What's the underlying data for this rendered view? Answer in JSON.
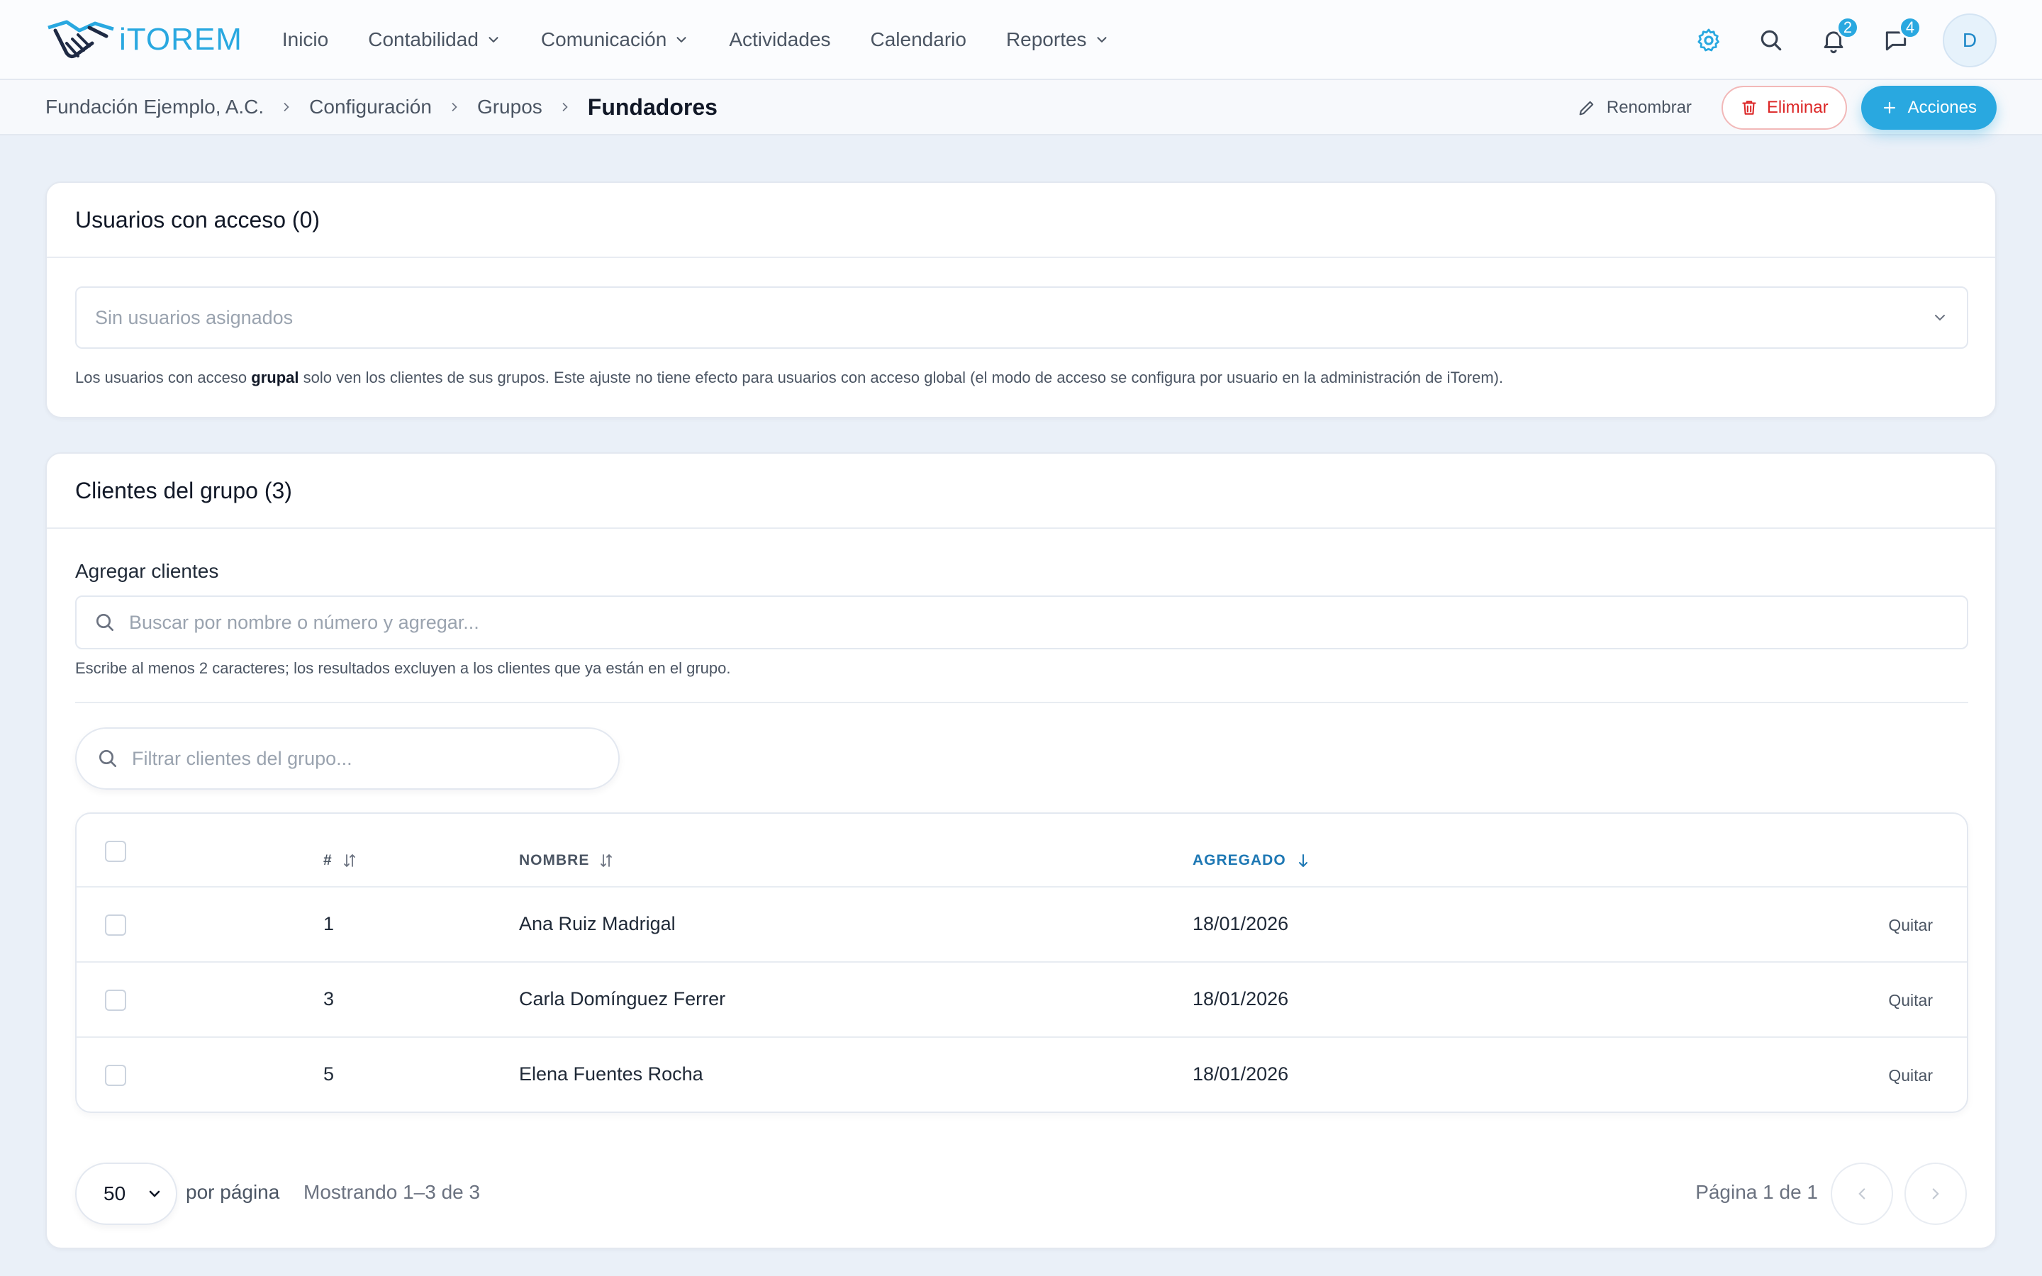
{
  "app": {
    "logo_text": "iTOREM"
  },
  "nav": {
    "items": [
      {
        "label": "Inicio",
        "dropdown": false
      },
      {
        "label": "Contabilidad",
        "dropdown": true
      },
      {
        "label": "Comunicación",
        "dropdown": true
      },
      {
        "label": "Actividades",
        "dropdown": false
      },
      {
        "label": "Calendario",
        "dropdown": false
      },
      {
        "label": "Reportes",
        "dropdown": true
      }
    ],
    "notifications_count": "2",
    "messages_count": "4",
    "avatar_initial": "D",
    "icons": [
      "gear-icon",
      "search-icon",
      "bell-icon",
      "chat-icon"
    ]
  },
  "breadcrumb": {
    "items": [
      "Fundación Ejemplo, A.C.",
      "Configuración",
      "Grupos"
    ],
    "current": "Fundadores"
  },
  "toolbar": {
    "rename_label": "Renombrar",
    "delete_label": "Eliminar",
    "actions_label": "Acciones"
  },
  "access_card": {
    "title": "Usuarios con acceso (0)",
    "select_placeholder": "Sin usuarios asignados",
    "note_before": "Los usuarios con acceso ",
    "note_bold": "grupal",
    "note_after": " solo ven los clientes de sus grupos. Este ajuste no tiene efecto para usuarios con acceso global (el modo de acceso se configura por usuario en la administración de iTorem)."
  },
  "clients_card": {
    "title": "Clientes del grupo (3)",
    "add_label": "Agregar clientes",
    "add_placeholder": "Buscar por nombre o número y agregar...",
    "hint": "Escribe al menos 2 caracteres; los resultados excluyen a los clientes que ya están en el grupo.",
    "filter_placeholder": "Filtrar clientes del grupo..."
  },
  "table": {
    "headers": [
      "#",
      "NOMBRE",
      "AGREGADO"
    ],
    "sorted_column": "AGREGADO",
    "remove_label": "Quitar",
    "rows": [
      {
        "num": "1",
        "name": "Ana Ruiz Madrigal",
        "added": "18/01/2026"
      },
      {
        "num": "3",
        "name": "Carla Domínguez Ferrer",
        "added": "18/01/2026"
      },
      {
        "num": "5",
        "name": "Elena Fuentes Rocha",
        "added": "18/01/2026"
      }
    ]
  },
  "pagination": {
    "page_size": "50",
    "per_page_label": "por página",
    "showing": "Mostrando 1–3 de 3",
    "page_info": "Página 1 de 1"
  },
  "colors": {
    "accent": "#29a8e0",
    "danger": "#dc2626",
    "background": "#eaf0f8"
  }
}
